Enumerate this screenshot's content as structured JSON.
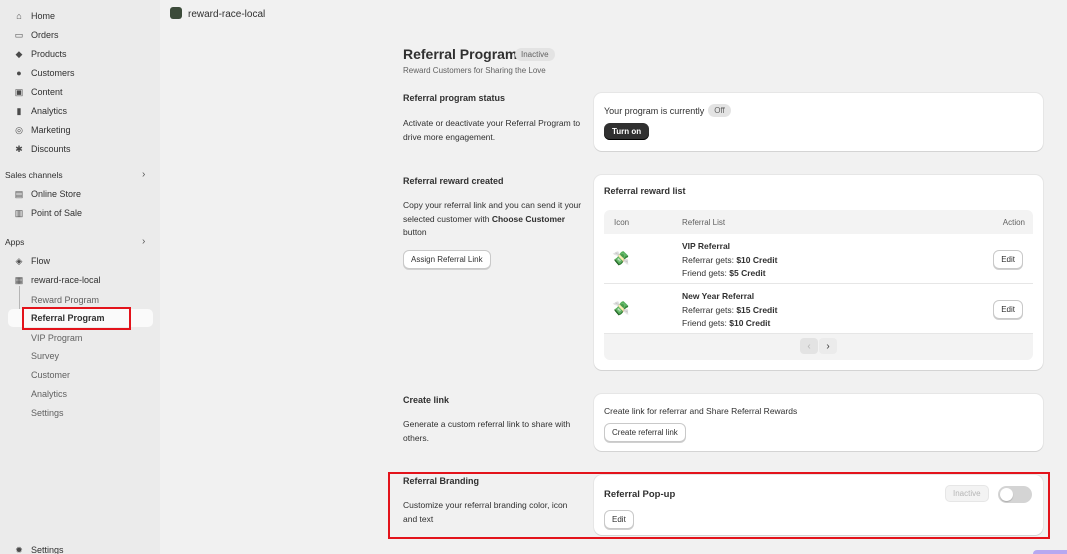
{
  "sidebar": {
    "nav": [
      {
        "label": "Home",
        "icon": "home-icon"
      },
      {
        "label": "Orders",
        "icon": "inbox-icon"
      },
      {
        "label": "Products",
        "icon": "tag-icon"
      },
      {
        "label": "Customers",
        "icon": "person-icon"
      },
      {
        "label": "Content",
        "icon": "content-icon"
      },
      {
        "label": "Analytics",
        "icon": "bar-chart-icon"
      },
      {
        "label": "Marketing",
        "icon": "target-icon"
      },
      {
        "label": "Discounts",
        "icon": "discount-icon"
      }
    ],
    "sales_channels_label": "Sales channels",
    "channels": [
      {
        "label": "Online Store",
        "icon": "store-icon"
      },
      {
        "label": "Point of Sale",
        "icon": "pos-icon"
      }
    ],
    "apps_label": "Apps",
    "apps": [
      {
        "label": "Flow",
        "icon": "flow-icon"
      },
      {
        "label": "reward-race-local",
        "icon": "app-icon"
      }
    ],
    "sub_items": [
      "Reward Program",
      "Referral Program",
      "VIP Program",
      "Survey",
      "Customer",
      "Analytics",
      "Settings"
    ],
    "settings_label": "Settings"
  },
  "topbar": {
    "store_name": "reward-race-local"
  },
  "page": {
    "title": "Referral Program",
    "status_badge": "Inactive",
    "subtitle": "Reward Customers for Sharing the Love"
  },
  "status_section": {
    "title": "Referral program status",
    "desc": "Activate or deactivate your Referral Program to drive more engagement.",
    "card_text": "Your program is currently",
    "card_badge": "Off",
    "button": "Turn on"
  },
  "reward_section": {
    "title": "Referral reward created",
    "desc_pre": "Copy your referral link and you can send it your selected customer with ",
    "desc_bold": "Choose Customer",
    "desc_post": " button",
    "assign_button": "Assign Referral Link",
    "card_title": "Referral reward list",
    "columns": {
      "icon": "Icon",
      "list": "Referral List",
      "action": "Action"
    },
    "rows": [
      {
        "name": "VIP Referral",
        "referrer_label": "Referrar gets: ",
        "referrer_value": "$10 Credit",
        "friend_label": "Friend gets: ",
        "friend_value": "$5 Credit",
        "edit": "Edit"
      },
      {
        "name": "New Year Referral",
        "referrer_label": "Referrar gets: ",
        "referrer_value": "$15 Credit",
        "friend_label": "Friend gets: ",
        "friend_value": "$10 Credit",
        "edit": "Edit"
      }
    ],
    "pager_prev": "‹",
    "pager_next": "›"
  },
  "link_section": {
    "title": "Create link",
    "desc": "Generate a custom referral link to share with others.",
    "card_text": "Create link for referrar and Share Referral Rewards",
    "button": "Create referral link"
  },
  "branding_section": {
    "title": "Referral Branding",
    "desc": "Customize your referral branding color, icon and text",
    "card_title": "Referral Pop-up",
    "status": "Inactive",
    "edit": "Edit"
  }
}
